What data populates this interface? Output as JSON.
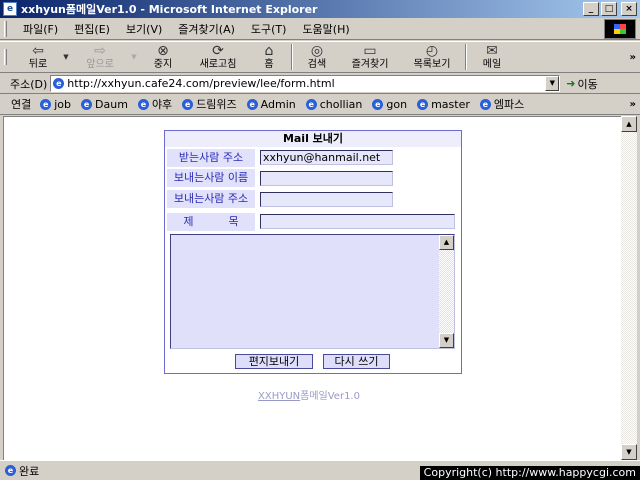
{
  "window": {
    "title": "xxhyun폼메일Ver1.0 - Microsoft Internet Explorer"
  },
  "menu": [
    "파일(F)",
    "편집(E)",
    "보기(V)",
    "즐겨찾기(A)",
    "도구(T)",
    "도움말(H)"
  ],
  "toolbar": {
    "back": "뒤로",
    "forward": "앞으로",
    "stop": "중지",
    "refresh": "새로고침",
    "home": "홈",
    "search": "검색",
    "favorites": "즐겨찾기",
    "history": "목록보기",
    "mail": "메일"
  },
  "address": {
    "label": "주소(D)",
    "url": "http://xxhyun.cafe24.com/preview/lee/form.html",
    "go": "이동"
  },
  "links": {
    "label": "연결",
    "items": [
      "job",
      "Daum",
      "야후",
      "드림위즈",
      "Admin",
      "chollian",
      "gon",
      "master",
      "엠파스"
    ]
  },
  "form": {
    "title": "Mail 보내기",
    "to_label": "받는사람 주소",
    "to_value": "xxhyun@hanmail.net",
    "from_name_label": "보내는사람 이름",
    "from_name_value": "",
    "from_addr_label": "보내는사람 주소",
    "from_addr_value": "",
    "subject_label": "제          목",
    "subject_value": "",
    "body_value": "",
    "send_button": "편지보내기",
    "reset_button": "다시 쓰기"
  },
  "footer": {
    "brand": "XXHYUN",
    "suffix": "폼메일Ver1.0"
  },
  "status": {
    "text": "완료"
  },
  "copyright": "Copyright(c) http://www.happycgi.com"
}
